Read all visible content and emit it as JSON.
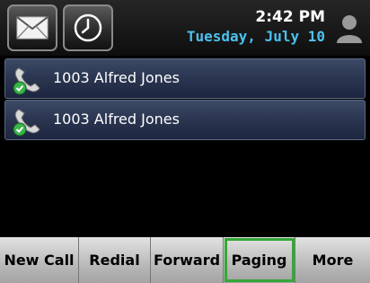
{
  "status_bar": {
    "time": "2:42 PM",
    "date": "Tuesday, July 10",
    "icons": [
      "messages-envelope-icon",
      "clock-icon",
      "user-profile-icon"
    ],
    "date_color": "#4cc1ee"
  },
  "lines": [
    {
      "label": "1003 Alfred Jones",
      "icon": "phone-line-registered-icon"
    },
    {
      "label": "1003 Alfred Jones",
      "icon": "phone-line-registered-icon"
    }
  ],
  "softkeys": [
    {
      "label": "New Call"
    },
    {
      "label": "Redial"
    },
    {
      "label": "Forward"
    },
    {
      "label": "Paging",
      "highlighted": true
    },
    {
      "label": "More"
    }
  ],
  "colors": {
    "highlight": "#35a838",
    "line_background": "#2a3550"
  }
}
